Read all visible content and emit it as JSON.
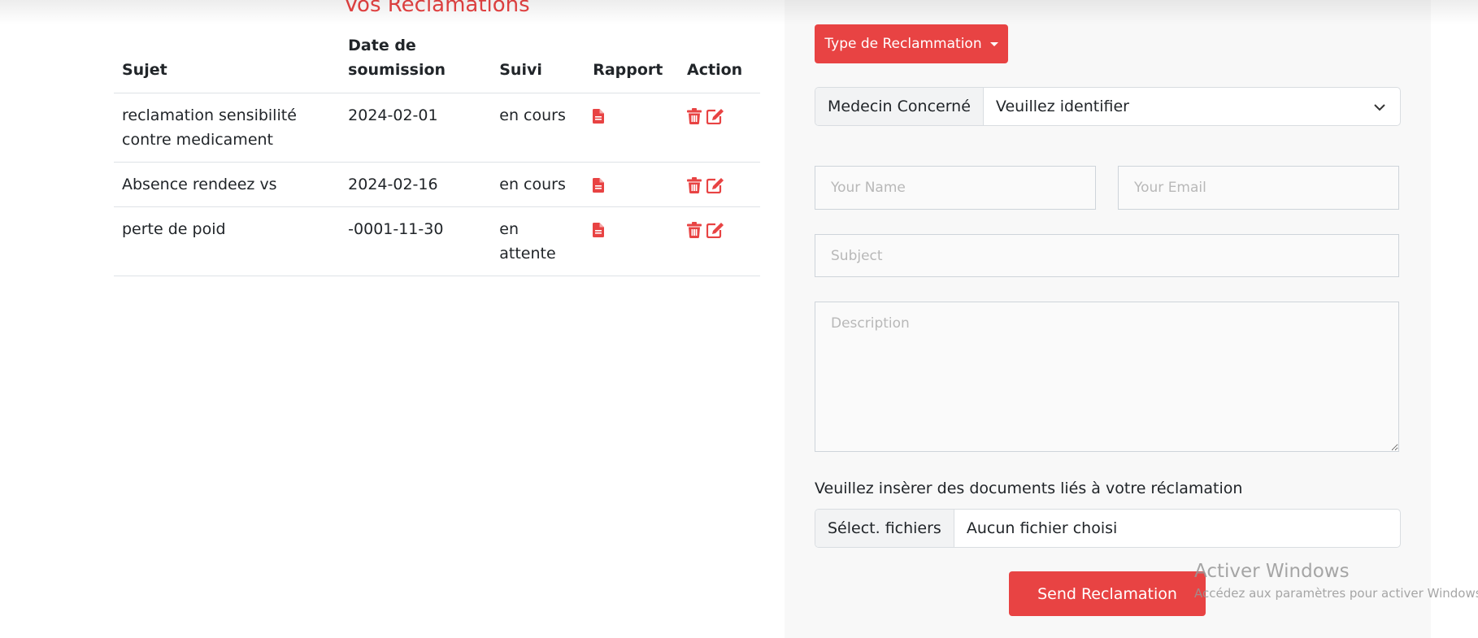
{
  "left_panel": {
    "title": "Vos Reclamations",
    "table": {
      "headers": [
        "Sujet",
        "Date de soumission",
        "Suivi",
        "Rapport",
        "Action"
      ],
      "rows": [
        {
          "sujet": "reclamation sensibilité contre medicament",
          "date": "2024-02-01",
          "suivi": "en cours"
        },
        {
          "sujet": "Absence rendeez vs",
          "date": "2024-02-16",
          "suivi": "en cours"
        },
        {
          "sujet": "perte de poid",
          "date": "-0001-11-30",
          "suivi": "en attente"
        }
      ],
      "row_icons": {
        "rapport": "file-document-icon",
        "delete": "trash-icon",
        "edit": "edit-icon"
      }
    }
  },
  "form": {
    "type_button_label": "Type de Reclammation",
    "medecin_label": "Medecin Concerné",
    "medecin_selected": "Veuillez identifier",
    "name_placeholder": "Your Name",
    "email_placeholder": "Your Email",
    "subject_placeholder": "Subject",
    "description_placeholder": "Description",
    "documents_label": "Veuillez insèrer des documents liés à votre réclamation",
    "file_button_label": "Sélect. fichiers",
    "file_status": "Aucun fichier choisi",
    "submit_label": "Send Reclamation"
  },
  "watermark": {
    "title": "Activer Windows",
    "subtitle": "Accédez aux paramètres pour activer Windows."
  },
  "colors": {
    "accent": "#e84343",
    "panel_background": "#f8f8f8"
  }
}
